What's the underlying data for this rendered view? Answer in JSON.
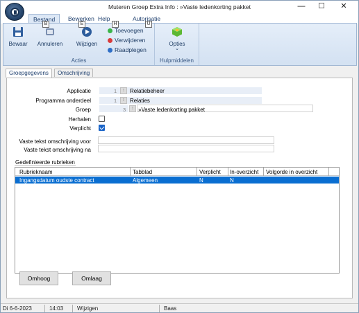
{
  "window": {
    "title": "Muteren Groep Extra Info : »Vaste ledenkorting pakket"
  },
  "title_controls": {
    "minimize": "—",
    "maximize": "☐",
    "close": "✕"
  },
  "ribbon_tabs": [
    {
      "label": "Bestand",
      "keytip": "B"
    },
    {
      "label": "Bewerken",
      "keytip": "E"
    },
    {
      "label": "Help",
      "keytip": "H"
    },
    {
      "label": "Autorisatie",
      "keytip": "U"
    }
  ],
  "ribbon": {
    "group_acties": {
      "label": "Acties",
      "save_label": "Bewaar",
      "cancel_label": "Annuleren",
      "edit_label": "Wijzigen",
      "add_label": "Toevoegen",
      "delete_label": "Verwijderen",
      "view_label": "Raadplegen"
    },
    "group_hulp": {
      "label": "Hulpmiddelen",
      "options_label": "Opties",
      "options_arrow": "⌄"
    }
  },
  "tabs": [
    {
      "label": "Groepgegevens",
      "active": true
    },
    {
      "label": "Omschrijving",
      "active": false
    }
  ],
  "form": {
    "applicatie": {
      "label": "Applicatie",
      "num": "1",
      "value": "Relatiebeheer"
    },
    "programma": {
      "label": "Programma onderdeel",
      "num": "1",
      "value": "Relaties"
    },
    "groep": {
      "label": "Groep",
      "num": "3",
      "value": "»Vaste ledenkorting pakket"
    },
    "herhalen": {
      "label": "Herhalen",
      "checked": false
    },
    "verplicht": {
      "label": "Verplicht",
      "checked": true
    },
    "tekst_voor": {
      "label": "Vaste tekst omschrijving voor",
      "value": ""
    },
    "tekst_na": {
      "label": "Vaste tekst omschrijving na",
      "value": ""
    },
    "lookup_glyph": "⁝"
  },
  "grid": {
    "title": "Gedefinieerde rubrieken",
    "columns": [
      "Rubrieknaam",
      "Tabblad",
      "Verplicht",
      "In-overzicht",
      "Volgorde in overzicht"
    ],
    "rows": [
      [
        "Ingangsdatum oudste contract",
        "Algemeen",
        "N",
        "N",
        ""
      ]
    ]
  },
  "buttons": {
    "up_label": "Omhoog",
    "down_label": "Omlaag"
  },
  "status": {
    "date": "Di 6-6-2023",
    "time": "14:03",
    "mode": "Wijzigen",
    "user": "Baas"
  },
  "colors": {
    "accent": "#0a6ed1",
    "ribbon_bg": "#dce7f5",
    "checkbox": "#1a64c8"
  }
}
